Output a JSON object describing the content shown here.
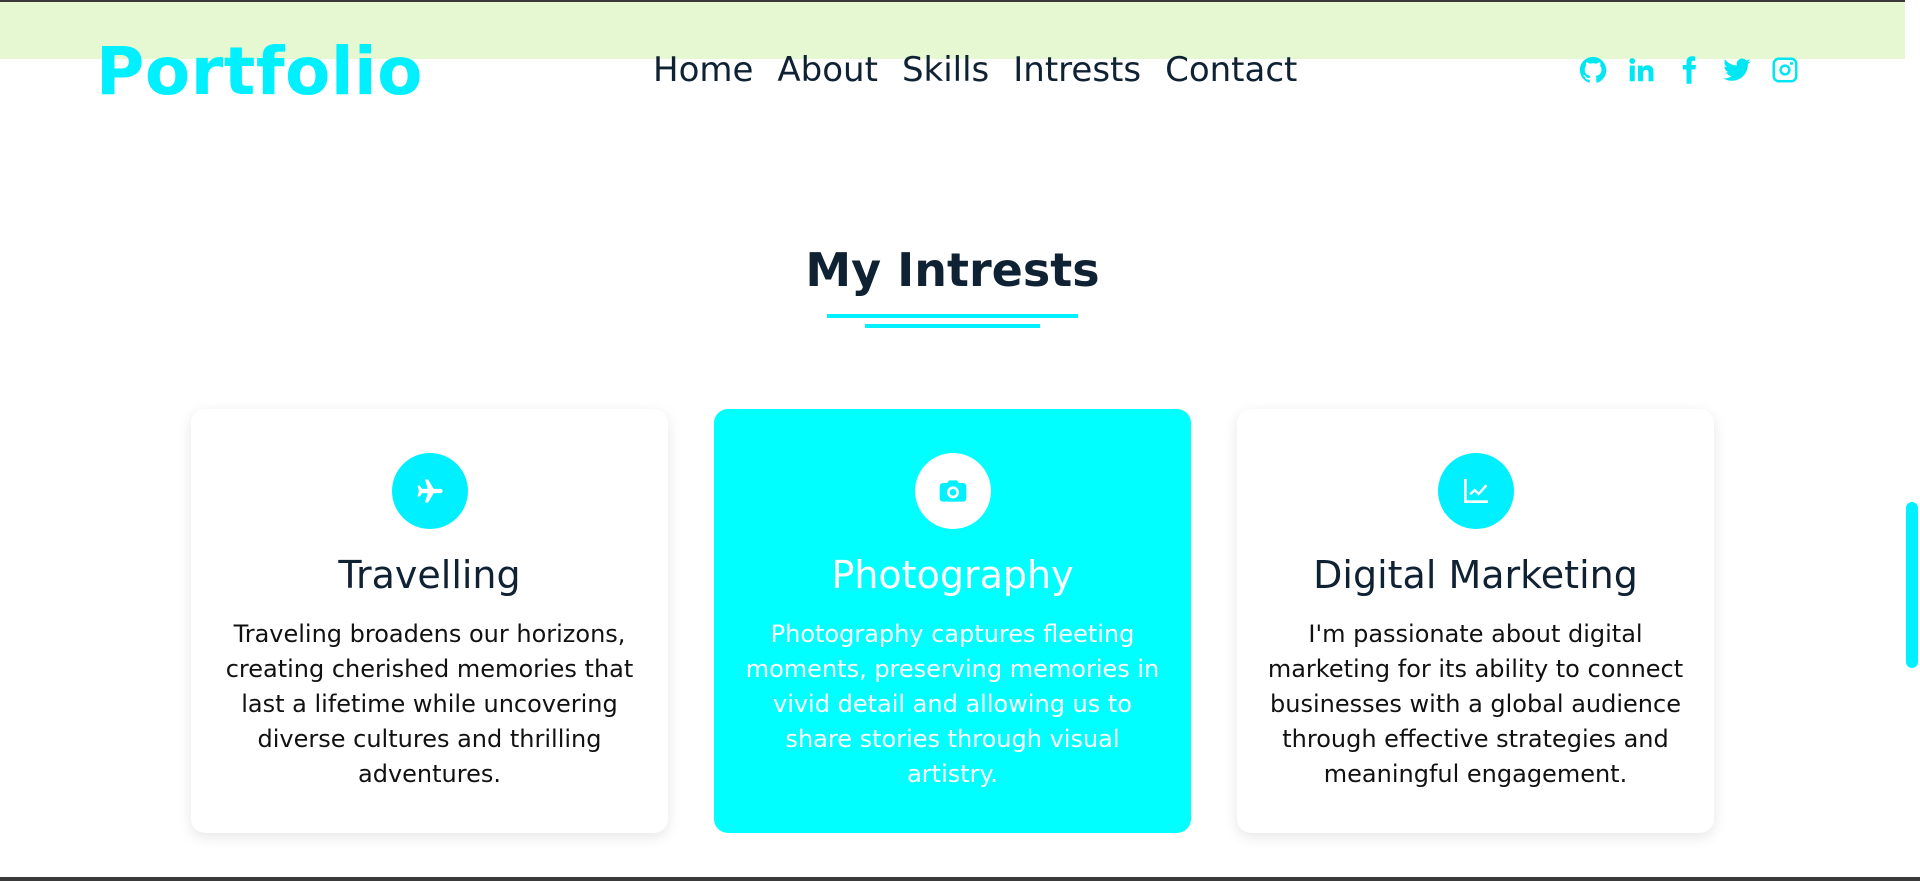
{
  "header": {
    "logo": "Portfolio",
    "nav": [
      "Home",
      "About",
      "Skills",
      "Intrests",
      "Contact"
    ],
    "socials": [
      "github-icon",
      "linkedin-icon",
      "facebook-icon",
      "twitter-icon",
      "instagram-icon"
    ]
  },
  "section": {
    "title": "My Intrests"
  },
  "cards": [
    {
      "icon": "plane-icon",
      "title": "Travelling",
      "text": "Traveling broadens our horizons, creating cherished memories that last a lifetime while uncovering diverse cultures and thrilling adventures."
    },
    {
      "icon": "camera-icon",
      "title": "Photography",
      "text": "Photography captures fleeting moments, preserving memories in vivid detail and allowing us to share stories through visual artistry."
    },
    {
      "icon": "chart-icon",
      "title": "Digital Marketing",
      "text": "I'm passionate about digital marketing for its ability to connect businesses with a global audience through effective strategies and meaningful engagement."
    }
  ],
  "colors": {
    "accent": "#00f0ff",
    "header_band": "#e6f8d2",
    "text_dark": "#0f2233"
  }
}
